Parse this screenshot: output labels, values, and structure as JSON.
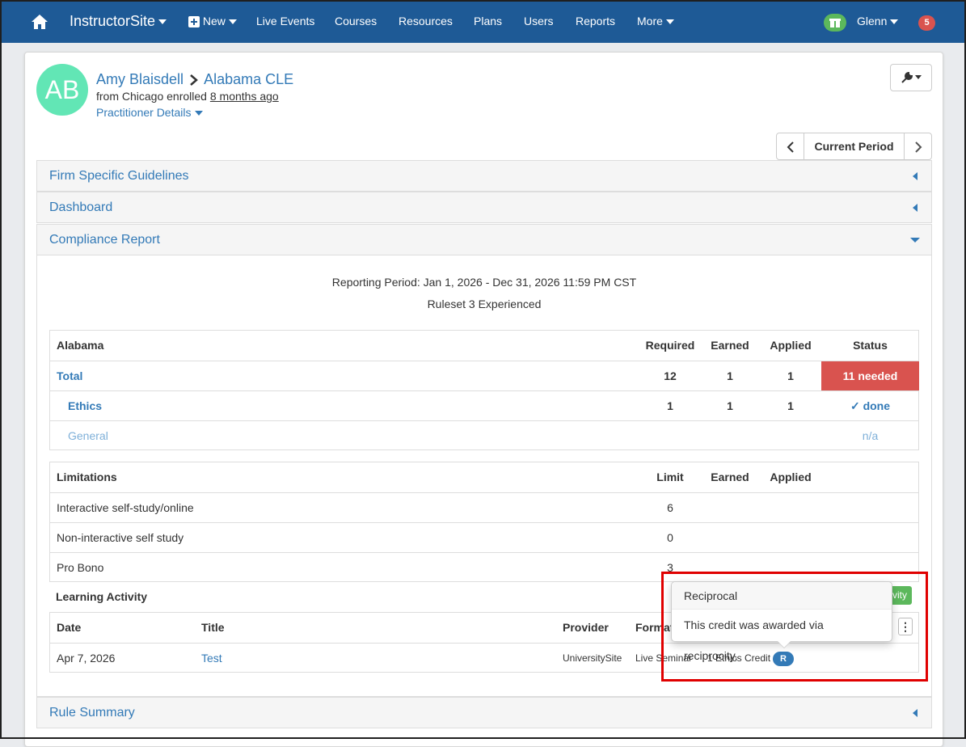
{
  "navbar": {
    "brand": "InstructorSite",
    "new_label": "New",
    "items": [
      "Live Events",
      "Courses",
      "Resources",
      "Plans",
      "Users",
      "Reports"
    ],
    "more_label": "More",
    "user_name": "Glenn",
    "notification_count": "5",
    "accent_color": "#1e5a96"
  },
  "header": {
    "avatar_initials": "AB",
    "user_name": "Amy Blaisdell",
    "program": "Alabama CLE",
    "sub_prefix": "from Chicago enrolled",
    "enrolled_ago": "8 months ago",
    "details_label": "Practitioner Details"
  },
  "period_nav": {
    "label": "Current Period"
  },
  "accordion": {
    "firm": "Firm Specific Guidelines",
    "dashboard": "Dashboard",
    "compliance": "Compliance Report",
    "rule_summary": "Rule Summary"
  },
  "report": {
    "period": "Reporting Period: Jan 1, 2026 - Dec 31, 2026 11:59 PM CST",
    "ruleset": "Ruleset 3 Experienced"
  },
  "requirements": {
    "headers": {
      "name": "Alabama",
      "required": "Required",
      "earned": "Earned",
      "applied": "Applied",
      "status": "Status"
    },
    "rows": [
      {
        "name": "Total",
        "required": "12",
        "earned": "1",
        "applied": "1",
        "status": "11 needed"
      },
      {
        "name": "Ethics",
        "required": "1",
        "earned": "1",
        "applied": "1",
        "status": "done"
      },
      {
        "name": "General",
        "required": "",
        "earned": "",
        "applied": "",
        "status": "n/a"
      }
    ]
  },
  "limitations": {
    "headers": {
      "name": "Limitations",
      "limit": "Limit",
      "earned": "Earned",
      "applied": "Applied"
    },
    "rows": [
      {
        "name": "Interactive self-study/online",
        "limit": "6"
      },
      {
        "name": "Non-interactive self study",
        "limit": "0"
      },
      {
        "name": "Pro Bono",
        "limit": "3"
      }
    ]
  },
  "learning_activity": {
    "title": "Learning Activity",
    "add_button_fragment": "vity",
    "headers": {
      "date": "Date",
      "title": "Title",
      "provider": "Provider",
      "format": "Format"
    },
    "rows": [
      {
        "date": "Apr 7, 2026",
        "title": "Test",
        "provider": "UniversitySite",
        "format": "Live Seminar",
        "credit": "1 Ethics Credit",
        "badge": "R"
      }
    ]
  },
  "popover": {
    "title": "Reciprocal",
    "body": "This credit was awarded via reciprocity."
  }
}
